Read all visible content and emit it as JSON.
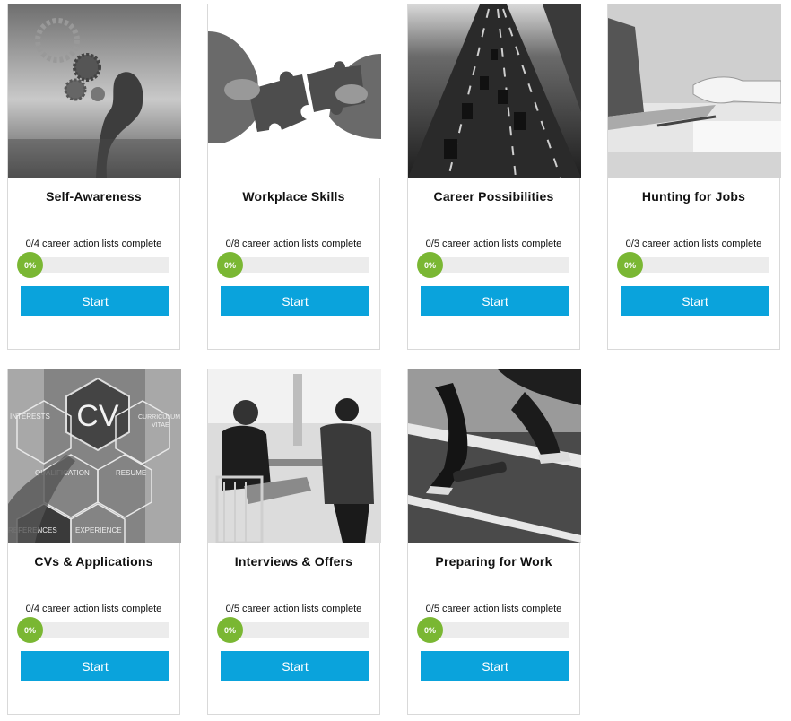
{
  "modules": [
    {
      "title": "Self-Awareness",
      "progress_text": "0/4 career action lists complete",
      "percent_label": "0%",
      "progress": 0,
      "button_label": "Start",
      "image": "head-with-gears-image"
    },
    {
      "title": "Workplace Skills",
      "progress_text": "0/8 career action lists complete",
      "percent_label": "0%",
      "progress": 0,
      "button_label": "Start",
      "image": "puzzle-pieces-image"
    },
    {
      "title": "Career Possibilities",
      "progress_text": "0/5 career action lists complete",
      "percent_label": "0%",
      "progress": 0,
      "button_label": "Start",
      "image": "highway-traffic-image"
    },
    {
      "title": "Hunting for Jobs",
      "progress_text": "0/3 career action lists complete",
      "percent_label": "0%",
      "progress": 0,
      "button_label": "Start",
      "image": "laptop-typing-image"
    },
    {
      "title": "CVs & Applications",
      "progress_text": "0/4 career action lists complete",
      "percent_label": "0%",
      "progress": 0,
      "button_label": "Start",
      "image": "cv-hexagons-image",
      "image_text": [
        "CV",
        "INTERESTS",
        "CURRICULUM",
        "VITAE",
        "QUALIFICATION",
        "RESUME",
        "REFERENCES",
        "EXPERIENCE"
      ]
    },
    {
      "title": "Interviews & Offers",
      "progress_text": "0/5 career action lists complete",
      "percent_label": "0%",
      "progress": 0,
      "button_label": "Start",
      "image": "interview-meeting-image"
    },
    {
      "title": "Preparing for Work",
      "progress_text": "0/5 career action lists complete",
      "percent_label": "0%",
      "progress": 0,
      "button_label": "Start",
      "image": "sprinter-start-image"
    }
  ],
  "colors": {
    "accent_button": "#0aa3dc",
    "progress_green": "#7ab733",
    "track": "#ececec",
    "card_border": "#d9d9d9"
  }
}
